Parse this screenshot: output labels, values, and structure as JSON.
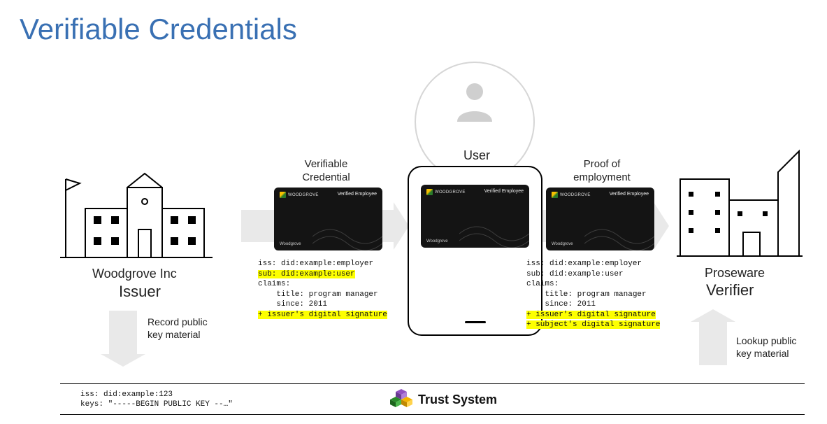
{
  "title": "Verifiable Credentials",
  "issuer": {
    "name": "Woodgrove Inc",
    "role": "Issuer"
  },
  "user": {
    "label": "User"
  },
  "verifier": {
    "name": "Proseware",
    "role": "Verifier"
  },
  "flow": {
    "vc_label": "Verifiable\nCredential",
    "proof_label": "Proof of\nemployment",
    "record_label": "Record public\nkey material",
    "lookup_label": "Lookup public\nkey material"
  },
  "card": {
    "brand": "WOODGROVE",
    "title": "Verified Employee",
    "footer": "Woodgrove"
  },
  "vc_payload": {
    "l1": "iss: did:example:employer",
    "l2": "sub: did:example:user",
    "l3": "claims:",
    "l4": "    title: program manager",
    "l5": "    since: 2011",
    "l6": "+ issuer's digital signature"
  },
  "proof_payload": {
    "l1": "iss: did:example:employer",
    "l2": "sub: did:example:user",
    "l3": "claims:",
    "l4": "    title: program manager",
    "l5": "    since: 2011",
    "l6": "+ issuer's digital signature",
    "l7": "+ subject's digital signature"
  },
  "trust": {
    "label": "Trust System",
    "record": "iss: did:example:123\nkeys: \"-----BEGIN PUBLIC KEY --…\""
  }
}
